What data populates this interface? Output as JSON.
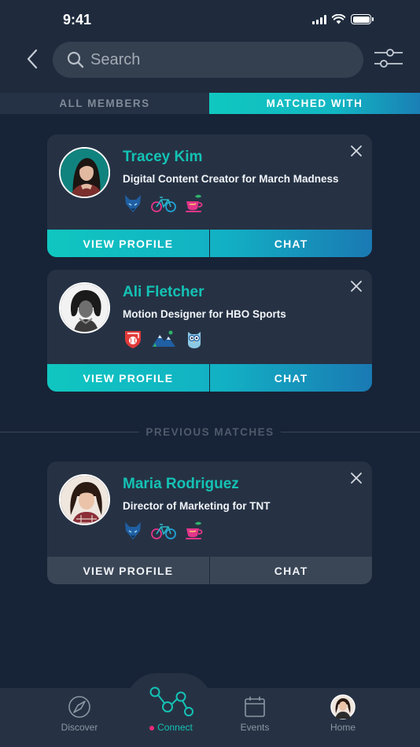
{
  "status_bar": {
    "time": "9:41"
  },
  "header": {
    "search_placeholder": "Search"
  },
  "tabs": [
    {
      "label": "ALL MEMBERS",
      "active": false
    },
    {
      "label": "MATCHED WITH",
      "active": true
    }
  ],
  "matches": [
    {
      "name": "Tracey Kim",
      "title": "Digital Content Creator for March Madness",
      "badges": [
        "wolf-icon",
        "bicycle-icon",
        "teacup-icon"
      ],
      "view_profile": "VIEW PROFILE",
      "chat": "CHAT"
    },
    {
      "name": "Ali Fletcher",
      "title": "Motion Designer for HBO Sports",
      "badges": [
        "baseball-shield-icon",
        "mountains-icon",
        "owl-icon"
      ],
      "view_profile": "VIEW PROFILE",
      "chat": "CHAT"
    }
  ],
  "previous_label": "PREVIOUS MATCHES",
  "previous": [
    {
      "name": "Maria Rodriguez",
      "title": "Director of Marketing for TNT",
      "badges": [
        "wolf-icon",
        "bicycle-icon",
        "teacup-icon"
      ],
      "view_profile": "VIEW PROFILE",
      "chat": "CHAT"
    }
  ],
  "nav": {
    "discover": "Discover",
    "connect": "Connect",
    "events": "Events",
    "home": "Home"
  },
  "colors": {
    "accent": "#14c2b4",
    "background": "#172336",
    "card": "#263244",
    "notification_dot": "#ec2a7a"
  }
}
